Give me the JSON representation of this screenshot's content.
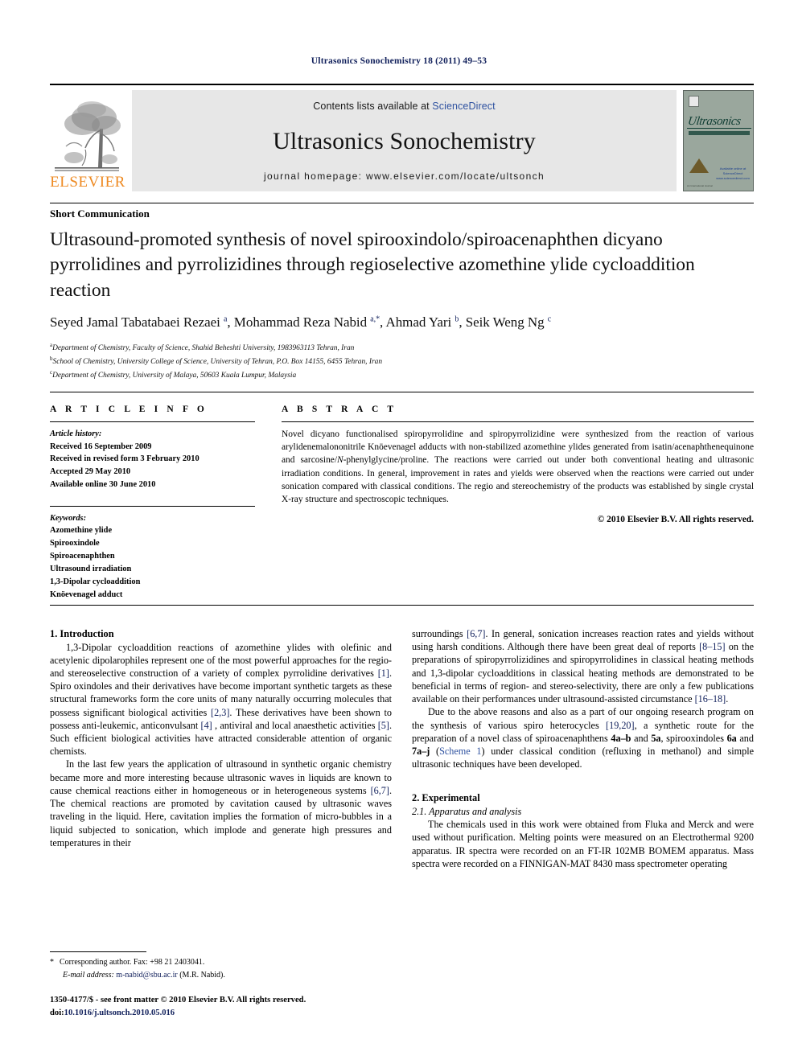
{
  "running_head": "Ultrasonics Sonochemistry 18 (2011) 49–53",
  "masthead": {
    "contents_prefix": "Contents lists available at ",
    "sciencedirect": "ScienceDirect",
    "journal_name": "Ultrasonics Sonochemistry",
    "homepage": "journal homepage: www.elsevier.com/locate/ultsonch",
    "publisher_logo_text": "ELSEVIER",
    "cover": {
      "title": "Ultrasonics",
      "subtitle": "SONOCHEMISTRY",
      "science_direct_note": "Available online at ScienceDirect www.sciencedirect.com",
      "fine_print": "An International Journal"
    },
    "colors": {
      "elsevier_orange": "#ee8a22",
      "link_blue": "#2f52a0",
      "panel_gray": "#e7e7e7",
      "cover_green": "#9aa79d"
    }
  },
  "doctype": "Short Communication",
  "title": "Ultrasound-promoted synthesis of novel spirooxindolo/spiroacenaphthen dicyano pyrrolidines and pyrrolizidines through regioselective azomethine ylide cycloaddition reaction",
  "authors_html": "Seyed Jamal Tabatabaei Rezaei <sup>a</sup>, Mohammad Reza Nabid <sup>a,*</sup>, Ahmad Yari <sup>b</sup>, Seik Weng Ng <sup>c</sup>",
  "affiliations": [
    {
      "marker": "a",
      "text": "Department of Chemistry, Faculty of Science, Shahid Beheshti University, 1983963113 Tehran, Iran"
    },
    {
      "marker": "b",
      "text": "School of Chemistry, University College of Science, University of Tehran, P.O. Box 14155, 6455 Tehran, Iran"
    },
    {
      "marker": "c",
      "text": "Department of Chemistry, University of Malaya, 50603 Kuala Lumpur, Malaysia"
    }
  ],
  "article_info": {
    "heading": "A R T I C L E   I N F O",
    "history_label": "Article history:",
    "history": [
      "Received 16 September 2009",
      "Received in revised form 3 February 2010",
      "Accepted 29 May 2010",
      "Available online 30 June 2010"
    ],
    "keywords_label": "Keywords:",
    "keywords": [
      "Azomethine ylide",
      "Spirooxindole",
      "Spiroacenaphthen",
      "Ultrasound irradiation",
      "1,3-Dipolar cycloaddition",
      "Knöevenagel adduct"
    ]
  },
  "abstract": {
    "heading": "A B S T R A C T",
    "text_html": "Novel dicyano functionalised spiropyrrolidine and spiropyrrolizidine were synthesized from the reaction of various arylidenemalononitrile Knöevenagel adducts with non-stabilized azomethine ylides generated from isatin/acenaphthenequinone and sarcosine/<i>N</i>-phenylglycine/proline. The reactions were carried out under both conventional heating and ultrasonic irradiation conditions. In general, improvement in rates and yields were observed when the reactions were carried out under sonication compared with classical conditions. The regio and stereochemistry of the products was established by single crystal X-ray structure and spectroscopic techniques.",
    "copyright": "© 2010 Elsevier B.V. All rights reserved."
  },
  "sections": {
    "introduction_heading": "1. Introduction",
    "intro_p1_html": "1,3-Dipolar cycloaddition reactions of azomethine ylides with olefinic and acetylenic dipolarophiles represent one of the most powerful approaches for the regio- and stereoselective construction of a variety of complex pyrrolidine derivatives <span class=\"ref\">[1]</span>. Spiro oxindoles and their derivatives have become important synthetic targets as these structural frameworks form the core units of many naturally occurring molecules that possess significant biological activities <span class=\"ref\">[2,3]</span>. These derivatives have been shown to possess anti-leukemic, anticonvulsant <span class=\"ref\">[4]</span> , antiviral and local anaesthetic activities <span class=\"ref\">[5]</span>. Such efficient biological activities have attracted considerable attention of organic chemists.",
    "intro_p2_html": "In the last few years the application of ultrasound in synthetic organic chemistry became more and more interesting because ultrasonic waves in liquids are known to cause chemical reactions either in homogeneous or in heterogeneous systems <span class=\"ref\">[6,7]</span>. The chemical reactions are promoted by cavitation caused by ultrasonic waves traveling in the liquid. Here, cavitation implies the formation of micro-bubbles in a liquid subjected to sonication, which implode and generate high pressures and temperatures in their",
    "intro_p3_html": "surroundings <span class=\"ref\">[6,7]</span>. In general, sonication increases reaction rates and yields without using harsh conditions. Although there have been great deal of reports <span class=\"ref\">[8–15]</span> on the preparations of spiropyrrolizidines and spiropyrrolidines in classical heating methods and 1,3-dipolar cycloadditions in classical heating methods are demonstrated to be beneficial in terms of region- and stereo-selectivity, there are only a few publications available on their performances under ultrasound-assisted circumstance <span class=\"ref\">[16–18]</span>.",
    "intro_p4_html": "Due to the above reasons and also as a part of our ongoing research program on the synthesis of various spiro heterocycles <span class=\"ref\">[19,20]</span>, a synthetic route for the preparation of a novel class of spiroacenaphthens <b class=\"cmp\">4a–b</b> and <b class=\"cmp\">5a</b>, spirooxindoles <b class=\"cmp\">6a</b> and <b class=\"cmp\">7a–j</b> (<span class=\"lnk\">Scheme 1</span>) under classical condition (refluxing in methanol) and simple ultrasonic techniques have been developed.",
    "experimental_heading": "2. Experimental",
    "apparatus_heading": "2.1. Apparatus and analysis",
    "apparatus_p1_html": "The chemicals used in this work were obtained from Fluka and Merck and were used without purification. Melting points were measured on an Electrothermal 9200 apparatus. IR spectra were recorded on an FT-IR 102MB BOMEM apparatus. Mass spectra were recorded on a FINNIGAN-MAT 8430 mass spectrometer operating"
  },
  "footnote": {
    "star": "*",
    "corresponding": "Corresponding author. Fax: +98 21 2403041.",
    "email_label": "E-mail address:",
    "email": "m-nabid@sbu.ac.ir",
    "email_owner": "(M.R. Nabid)."
  },
  "copyright_block": {
    "line1": "1350-4177/$ - see front matter © 2010 Elsevier B.V. All rights reserved.",
    "doi_label": "doi:",
    "doi": "10.1016/j.ultsonch.2010.05.016"
  }
}
